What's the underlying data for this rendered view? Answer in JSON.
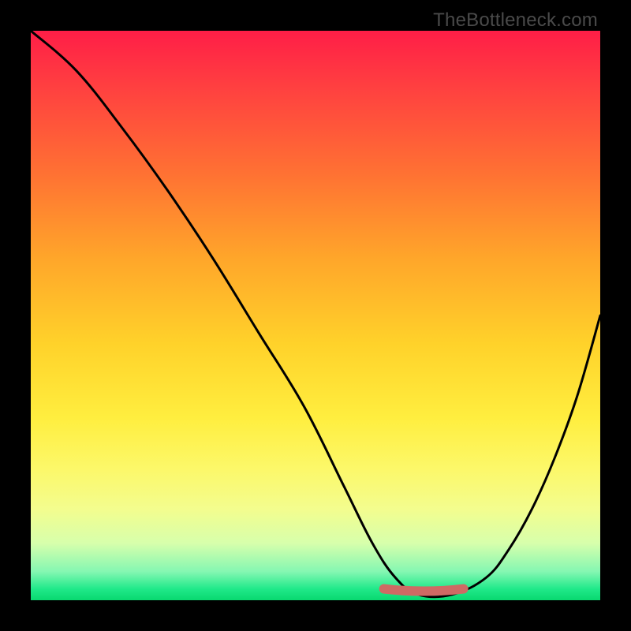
{
  "watermark": "TheBottleneck.com",
  "chart_data": {
    "type": "line",
    "title": "",
    "xlabel": "",
    "ylabel": "",
    "xlim": [
      0,
      100
    ],
    "ylim": [
      0,
      100
    ],
    "series": [
      {
        "name": "curve",
        "x": [
          0,
          8,
          16,
          24,
          32,
          40,
          48,
          55,
          60,
          64,
          68,
          74,
          80,
          84,
          88,
          92,
          96,
          100
        ],
        "values": [
          100,
          93,
          83,
          72,
          60,
          47,
          34,
          20,
          10,
          4,
          1,
          1,
          4,
          9,
          16,
          25,
          36,
          50
        ]
      },
      {
        "name": "highlight",
        "x": [
          62,
          76
        ],
        "values": [
          2,
          2
        ]
      }
    ],
    "colors": {
      "curve": "#000000",
      "highlight": "#cf6a64"
    }
  }
}
